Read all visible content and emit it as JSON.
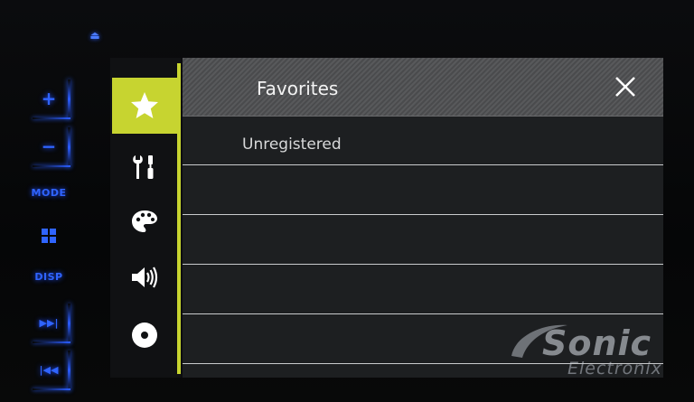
{
  "hardware": {
    "plus_label": "+",
    "minus_label": "−",
    "mode_label": "MODE",
    "apps_icon": "grid-icon",
    "disp_label": "DISP",
    "next_label": "▶▶|",
    "prev_label": "|◀◀",
    "eject_label": "⏏"
  },
  "sidebar": {
    "items": [
      {
        "icon": "star-icon",
        "active": true
      },
      {
        "icon": "tools-icon",
        "active": false
      },
      {
        "icon": "palette-icon",
        "active": false
      },
      {
        "icon": "speaker-icon",
        "active": false
      },
      {
        "icon": "disc-icon",
        "active": false
      }
    ]
  },
  "header": {
    "title": "Favorites",
    "close_icon": "close-icon"
  },
  "list": {
    "rows": [
      {
        "label": "Unregistered"
      },
      {
        "label": ""
      },
      {
        "label": ""
      },
      {
        "label": ""
      },
      {
        "label": ""
      }
    ]
  },
  "watermark": {
    "brand": "Sonic",
    "sub": "Electronix"
  },
  "colors": {
    "accent": "#c7d430",
    "hardware_blue": "#2f64ff",
    "header_bg": "#545557",
    "list_bg": "#1d1f21"
  }
}
